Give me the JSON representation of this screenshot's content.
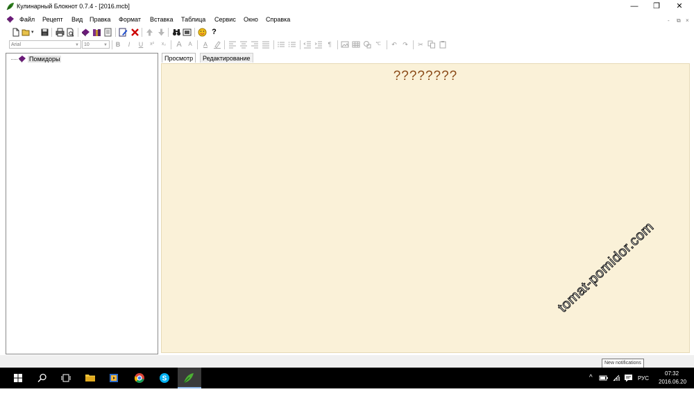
{
  "window": {
    "title": "Кулинарный Блокнот 0.7.4 - [2016.mcb]",
    "controls": {
      "minimize": "—",
      "maximize": "❐",
      "close": "✕"
    }
  },
  "menu": {
    "items": [
      "Файл",
      "Рецепт",
      "Вид",
      "Правка",
      "Формат",
      "Вставка",
      "Таблица",
      "Сервис",
      "Окно",
      "Справка"
    ],
    "mdi_controls": [
      "-",
      "⧉",
      "×"
    ]
  },
  "toolbar": {
    "icons": [
      "new-document-icon",
      "open-folder-icon",
      "save-icon",
      "print-icon",
      "print-preview-icon",
      "cookbook-icon",
      "books-icon",
      "page-icon",
      "edit-icon",
      "delete-icon",
      "arrow-up-icon",
      "arrow-down-icon",
      "binoculars-icon",
      "image-icon",
      "smiley-icon",
      "help-icon"
    ],
    "help_label": "?"
  },
  "format_toolbar": {
    "font_value": "Arial",
    "size_value": "10",
    "bold": "B",
    "italic": "I",
    "underline": "U",
    "superscript": "x²",
    "subscript": "x₂",
    "grow_font": "A",
    "shrink_font": "A",
    "font_color": "A"
  },
  "tree": {
    "items": [
      {
        "label": "Помидоры",
        "icon": "recipe-book-icon"
      }
    ]
  },
  "tabs": [
    {
      "label": "Просмотр",
      "active": true
    },
    {
      "label": "Редактирование",
      "active": false
    }
  ],
  "content": {
    "heading": "????????",
    "background": "#faf1d8",
    "heading_color": "#8a4a17"
  },
  "watermark": "tomat-pomidor.com",
  "taskbar": {
    "tooltip": "New notifications",
    "language": "РУС",
    "time": "07:32",
    "date": "2016.06.20"
  }
}
